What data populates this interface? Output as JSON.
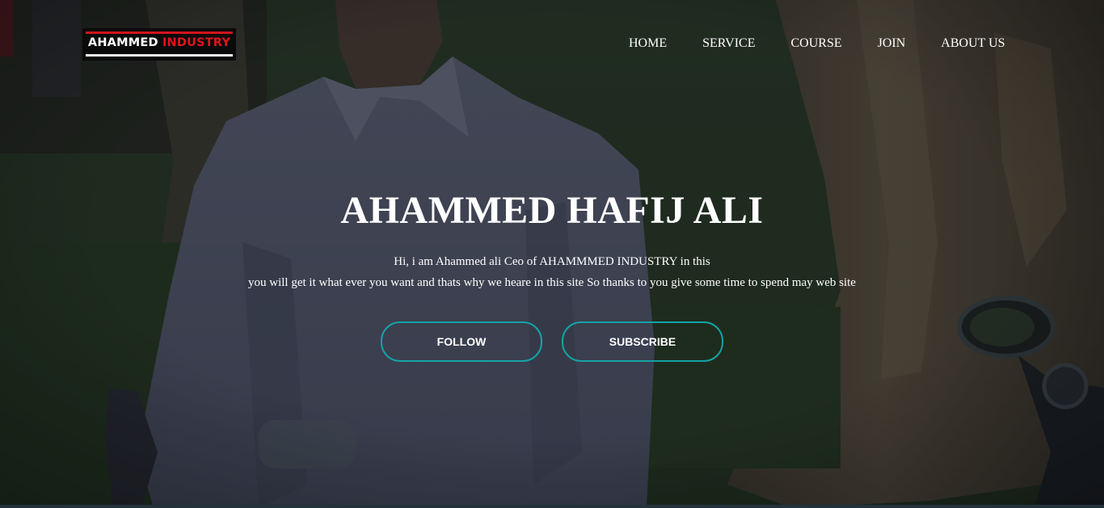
{
  "logo": {
    "word1": "AHAMMED",
    "word2": "INDUSTRY"
  },
  "nav": {
    "items": [
      "HOME",
      "SERVICE",
      "COURSE",
      "JOIN",
      "ABOUT US"
    ]
  },
  "hero": {
    "title": "AHAMMED HAFIJ ALI",
    "intro_line1": "Hi, i am Ahammed ali Ceo of AHAMMMED INDUSTRY in this",
    "intro_line2": "you will get it what ever you want and thats why we heare in this site So thanks to you give some time to spend may web site",
    "follow_label": "FOLLOW",
    "subscribe_label": "SUBSCRIBE"
  },
  "colors": {
    "accent_border": "#14a3a6",
    "logo_red": "#e0141c",
    "text": "#ffffff"
  }
}
